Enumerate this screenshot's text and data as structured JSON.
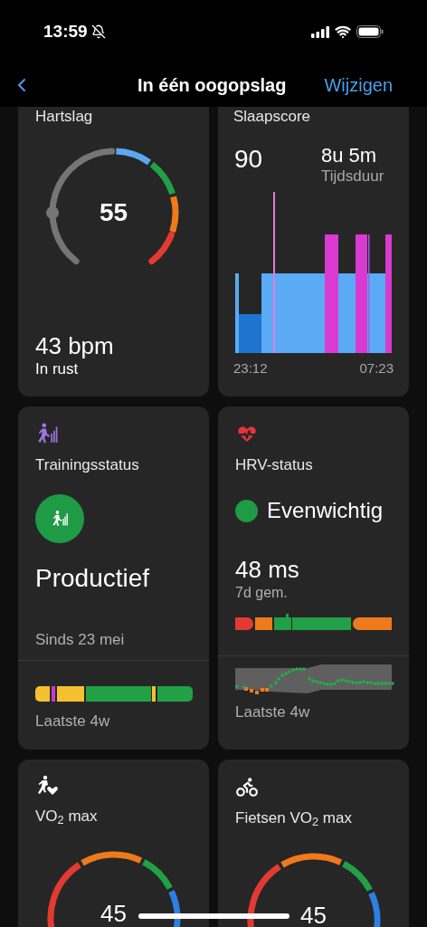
{
  "status_bar": {
    "time": "13:59"
  },
  "nav": {
    "title": "In één oogopslag",
    "action": "Wijzigen"
  },
  "cards": [
    {
      "kind": "heart_rate",
      "title": "Hartslag",
      "gauge_value": "55",
      "value": "43 bpm",
      "caption": "In rust"
    },
    {
      "kind": "sleep",
      "title": "Slaapscore",
      "score": "90",
      "duration": "8u 5m",
      "duration_label": "Tijdsduur",
      "start_time": "23:12",
      "end_time": "07:23"
    },
    {
      "kind": "training",
      "title": "Trainingsstatus",
      "status": "Productief",
      "since": "Sinds 23 mei",
      "footer": "Laatste 4w"
    },
    {
      "kind": "hrv",
      "title": "HRV-status",
      "status": "Evenwichtig",
      "value": "48 ms",
      "caption": "7d gem.",
      "footer": "Laatste 4w"
    },
    {
      "kind": "vo2_run",
      "title": "VO$_{2}$ max",
      "gauge_value": "45"
    },
    {
      "kind": "vo2_bike",
      "title": "Fietsen VO$_{2}$ max",
      "gauge_value": "45"
    }
  ]
}
